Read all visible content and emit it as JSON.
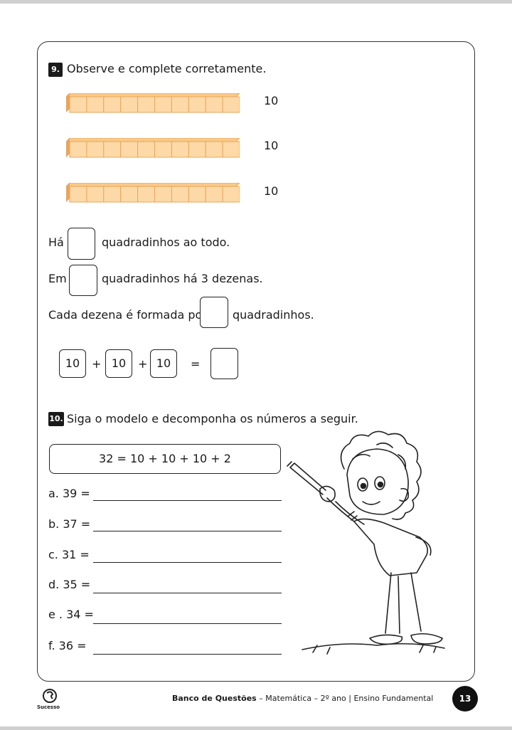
{
  "q9": {
    "number": "9.",
    "title": "Observe e complete corretamente.",
    "bars": [
      {
        "count_label": "10"
      },
      {
        "count_label": "10"
      },
      {
        "count_label": "10"
      }
    ],
    "line1": {
      "before": "Há",
      "after": "quadradinhos ao todo."
    },
    "line2": {
      "before": "Em",
      "after": "quadradinhos há 3 dezenas."
    },
    "line3": {
      "before": "Cada dezena é formada por",
      "after": "quadradinhos."
    },
    "sum": {
      "terms": [
        "10",
        "10",
        "10"
      ],
      "plus": "+",
      "equals": "="
    }
  },
  "q10": {
    "number": "10.",
    "title": "Siga o modelo e decomponha os números a seguir.",
    "model": "32 = 10 + 10 + 10 + 2",
    "items": [
      "a.  39 =",
      "b. 37 =",
      "c. 31 =",
      "d. 35 =",
      "e . 34 =",
      "f. 36 ="
    ]
  },
  "footer": {
    "bold": "Banco de Questões",
    "rest": " – Matemática – 2º ano | Ensino Fundamental",
    "page": "13",
    "logo_text": "Sucesso"
  },
  "colors": {
    "cube_fill": "#fdd9a8",
    "cube_edge": "#e9a55a",
    "cube_top": "#fbc987"
  }
}
